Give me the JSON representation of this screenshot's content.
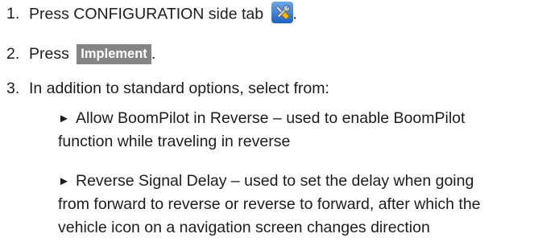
{
  "steps": [
    {
      "number": "1.",
      "before": "Press CONFIGURATION side tab",
      "after": "."
    },
    {
      "number": "2.",
      "before": "Press",
      "button_label": "Implement",
      "after": "."
    },
    {
      "number": "3.",
      "text": "In addition to standard options, select from:"
    }
  ],
  "icons": {
    "configuration_tab": "wrench-screwdriver-icon",
    "bullet": "right-triangle-bullet"
  },
  "bullet_glyph": "►",
  "options": [
    {
      "line1": "Allow BoomPilot in Reverse – used to enable BoomPilot",
      "line2": "function while traveling in reverse"
    },
    {
      "line1": "Reverse Signal Delay – used to set the delay when going",
      "line2": "from forward to reverse or reverse to forward, after which the",
      "line3": "vehicle icon on a navigation screen changes direction"
    }
  ],
  "colors": {
    "text": "#1c1c1c",
    "button_bg": "#858585",
    "button_text": "#ffffff",
    "icon_bg": "#2e74d0"
  }
}
